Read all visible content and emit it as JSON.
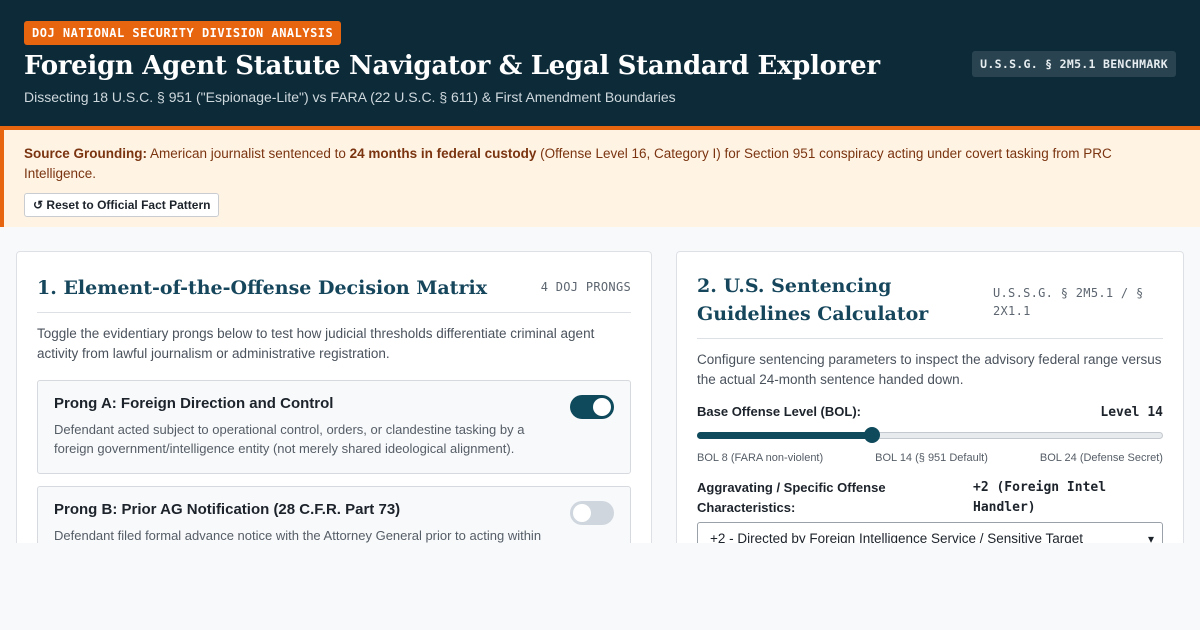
{
  "header": {
    "badge": "DOJ NATIONAL SECURITY DIVISION ANALYSIS",
    "title": "Foreign Agent Statute Navigator & Legal Standard Explorer",
    "subtitle": "Dissecting 18 U.S.C. § 951 (\"Espionage-Lite\") vs FARA (22 U.S.C. § 611) & First Amendment Boundaries",
    "benchmark": "U.S.S.G. § 2M5.1 BENCHMARK"
  },
  "notice": {
    "label": "Source Grounding:",
    "text_before": " American journalist sentenced to ",
    "emphasis": "24 months in federal custody",
    "text_after": " (Offense Level 16, Category I) for Section 951 conspiracy acting under covert tasking from PRC Intelligence.",
    "reset_icon": "↺",
    "reset_label": "Reset to Official Fact Pattern"
  },
  "matrix": {
    "title": "1. Element-of-the-Offense Decision Matrix",
    "tag": "4 DOJ PRONGS",
    "description": "Toggle the evidentiary prongs below to test how judicial thresholds differentiate criminal agent activity from lawful journalism or administrative registration.",
    "prongs": [
      {
        "title": "Prong A: Foreign Direction and Control",
        "description": "Defendant acted subject to operational control, orders, or clandestine tasking by a foreign government/intelligence entity (not merely shared ideological alignment).",
        "enabled": true
      },
      {
        "title": "Prong B: Prior AG Notification (28 C.F.R. Part 73)",
        "description": "Defendant filed formal advance notice with the Attorney General prior to acting within the",
        "enabled": false
      }
    ]
  },
  "calculator": {
    "title": "2. U.S. Sentencing Guidelines Calculator",
    "tag": "U.S.S.G. § 2M5.1 / § 2X1.1",
    "description": "Configure sentencing parameters to inspect the advisory federal range versus the actual 24-month sentence handed down.",
    "bol_label": "Base Offense Level (BOL):",
    "bol_value": "Level 14",
    "bol_level": 14,
    "bol_min": 8,
    "bol_max": 24,
    "ticks": [
      "BOL 8 (FARA non-violent)",
      "BOL 14 (§ 951 Default)",
      "BOL 24 (Defense Secret)"
    ],
    "agg_label": "Aggravating / Specific Offense Characteristics:",
    "agg_value": "+2 (Foreign Intel Handler)",
    "agg_selected": "+2 - Directed by Foreign Intelligence Service / Sensitive Target"
  }
}
